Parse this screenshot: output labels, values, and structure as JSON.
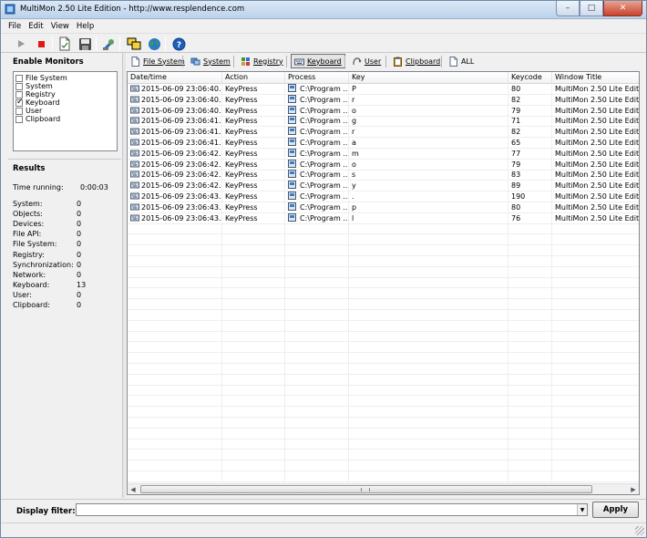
{
  "window": {
    "title": "MultiMon 2.50  Lite Edition -  http://www.resplendence.com",
    "minimize": "–",
    "maximize": "□",
    "close": "✕"
  },
  "menu": [
    "File",
    "Edit",
    "View",
    "Help"
  ],
  "toolbar_icons": [
    "play-icon",
    "stop-icon",
    "new-document-icon",
    "save-icon",
    "tools-icon",
    "windows-icon",
    "globe-icon",
    "help-icon"
  ],
  "left_panel": {
    "monitors_title": "Enable Monitors",
    "monitors": [
      {
        "label": "File System",
        "checked": false
      },
      {
        "label": "System",
        "checked": false
      },
      {
        "label": "Registry",
        "checked": false
      },
      {
        "label": "Keyboard",
        "checked": true
      },
      {
        "label": "User",
        "checked": false
      },
      {
        "label": "Clipboard",
        "checked": false
      }
    ],
    "results_title": "Results",
    "time_running_label": "Time running:",
    "time_running_value": "0:00:03",
    "counters": [
      {
        "label": "System:",
        "value": "0"
      },
      {
        "label": "Objects:",
        "value": "0"
      },
      {
        "label": "Devices:",
        "value": "0"
      },
      {
        "label": "File API:",
        "value": "0"
      },
      {
        "label": "File System:",
        "value": "0"
      },
      {
        "label": "Registry:",
        "value": "0"
      },
      {
        "label": "Synchronization:",
        "value": "0"
      },
      {
        "label": "Network:",
        "value": "0"
      },
      {
        "label": "Keyboard:",
        "value": "13"
      },
      {
        "label": "User:",
        "value": "0"
      },
      {
        "label": "Clipboard:",
        "value": "0"
      }
    ]
  },
  "filters": [
    {
      "label": "File System",
      "icon": "file-icon",
      "active": false
    },
    {
      "label": "System",
      "icon": "system-icon",
      "active": false
    },
    {
      "label": "Registry",
      "icon": "registry-icon",
      "active": false
    },
    {
      "label": "Keyboard",
      "icon": "keyboard-icon",
      "active": true
    },
    {
      "label": "User",
      "icon": "user-icon",
      "active": false
    },
    {
      "label": "Clipboard",
      "icon": "clipboard-icon",
      "active": false
    },
    {
      "label": "ALL",
      "icon": "all-icon",
      "active": false
    }
  ],
  "list": {
    "columns": [
      "Date/time",
      "Action",
      "Process",
      "Key",
      "Keycode",
      "Window Title"
    ],
    "rows": [
      {
        "datetime": "2015-06-09 23:06:40.4...",
        "action": "KeyPress",
        "process": "C:\\Program ...",
        "key": "P",
        "keycode": "80",
        "window": "MultiMon 2.50  Lite Edition..."
      },
      {
        "datetime": "2015-06-09 23:06:40.6...",
        "action": "KeyPress",
        "process": "C:\\Program ...",
        "key": "r",
        "keycode": "82",
        "window": "MultiMon 2.50  Lite Edition..."
      },
      {
        "datetime": "2015-06-09 23:06:40.7...",
        "action": "KeyPress",
        "process": "C:\\Program ...",
        "key": "o",
        "keycode": "79",
        "window": "MultiMon 2.50  Lite Edition..."
      },
      {
        "datetime": "2015-06-09 23:06:41.9...",
        "action": "KeyPress",
        "process": "C:\\Program ...",
        "key": "g",
        "keycode": "71",
        "window": "MultiMon 2.50  Lite Edition..."
      },
      {
        "datetime": "2015-06-09 23:06:41.1...",
        "action": "KeyPress",
        "process": "C:\\Program ...",
        "key": "r",
        "keycode": "82",
        "window": "MultiMon 2.50  Lite Edition..."
      },
      {
        "datetime": "2015-06-09 23:06:41.1...",
        "action": "KeyPress",
        "process": "C:\\Program ...",
        "key": "a",
        "keycode": "65",
        "window": "MultiMon 2.50  Lite Edition..."
      },
      {
        "datetime": "2015-06-09 23:06:42.9...",
        "action": "KeyPress",
        "process": "C:\\Program ...",
        "key": "m",
        "keycode": "77",
        "window": "MultiMon 2.50  Lite Edition..."
      },
      {
        "datetime": "2015-06-09 23:06:42.0...",
        "action": "KeyPress",
        "process": "C:\\Program ...",
        "key": "o",
        "keycode": "79",
        "window": "MultiMon 2.50  Lite Edition..."
      },
      {
        "datetime": "2015-06-09 23:06:42.1...",
        "action": "KeyPress",
        "process": "C:\\Program ...",
        "key": "s",
        "keycode": "83",
        "window": "MultiMon 2.50  Lite Edition..."
      },
      {
        "datetime": "2015-06-09 23:06:42.3...",
        "action": "KeyPress",
        "process": "C:\\Program ...",
        "key": "y",
        "keycode": "89",
        "window": "MultiMon 2.50  Lite Edition..."
      },
      {
        "datetime": "2015-06-09 23:06:43.7...",
        "action": "KeyPress",
        "process": "C:\\Program ...",
        "key": ".",
        "keycode": "190",
        "window": "MultiMon 2.50  Lite Edition..."
      },
      {
        "datetime": "2015-06-09 23:06:43.9...",
        "action": "KeyPress",
        "process": "C:\\Program ...",
        "key": "p",
        "keycode": "80",
        "window": "MultiMon 2.50  Lite Edition..."
      },
      {
        "datetime": "2015-06-09 23:06:43.9...",
        "action": "KeyPress",
        "process": "C:\\Program ...",
        "key": "l",
        "keycode": "76",
        "window": "MultiMon 2.50  Lite Edition..."
      }
    ]
  },
  "display_filter": {
    "label": "Display filter:",
    "value": "",
    "apply_label": "Apply"
  }
}
